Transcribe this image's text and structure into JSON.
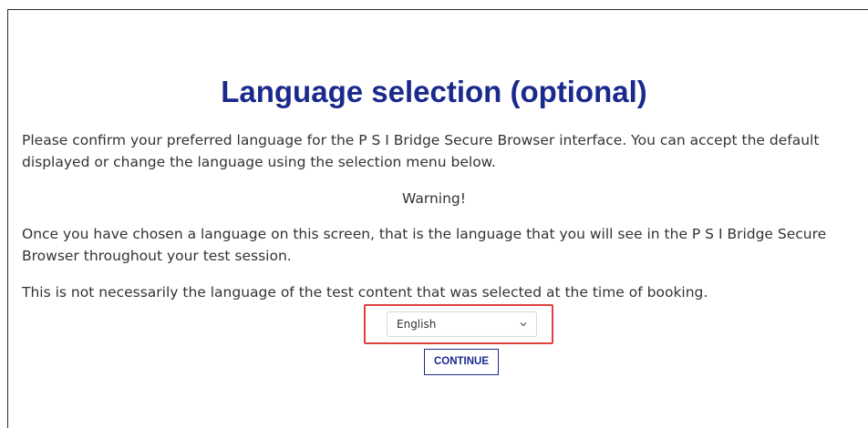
{
  "page": {
    "title": "Language selection (optional)",
    "intro": "Please confirm your preferred language for the P S I Bridge Secure Browser interface. You can accept the default displayed or change the language using the selection menu below.",
    "warning_label": "Warning!",
    "warning_text": "Once you have chosen a language on this screen, that is the language that you will see in the P S I Bridge Secure Browser throughout your test session.",
    "note": "This is not necessarily the language of the test content that was selected at the time of booking."
  },
  "language_select": {
    "selected": "English",
    "icon": "chevron-down-icon"
  },
  "continue_button": {
    "label": "CONTINUE"
  },
  "colors": {
    "title": "#1a2a8c",
    "highlight_border": "#e0413f",
    "button_border": "#1a2a8c",
    "body_text": "#333333"
  }
}
